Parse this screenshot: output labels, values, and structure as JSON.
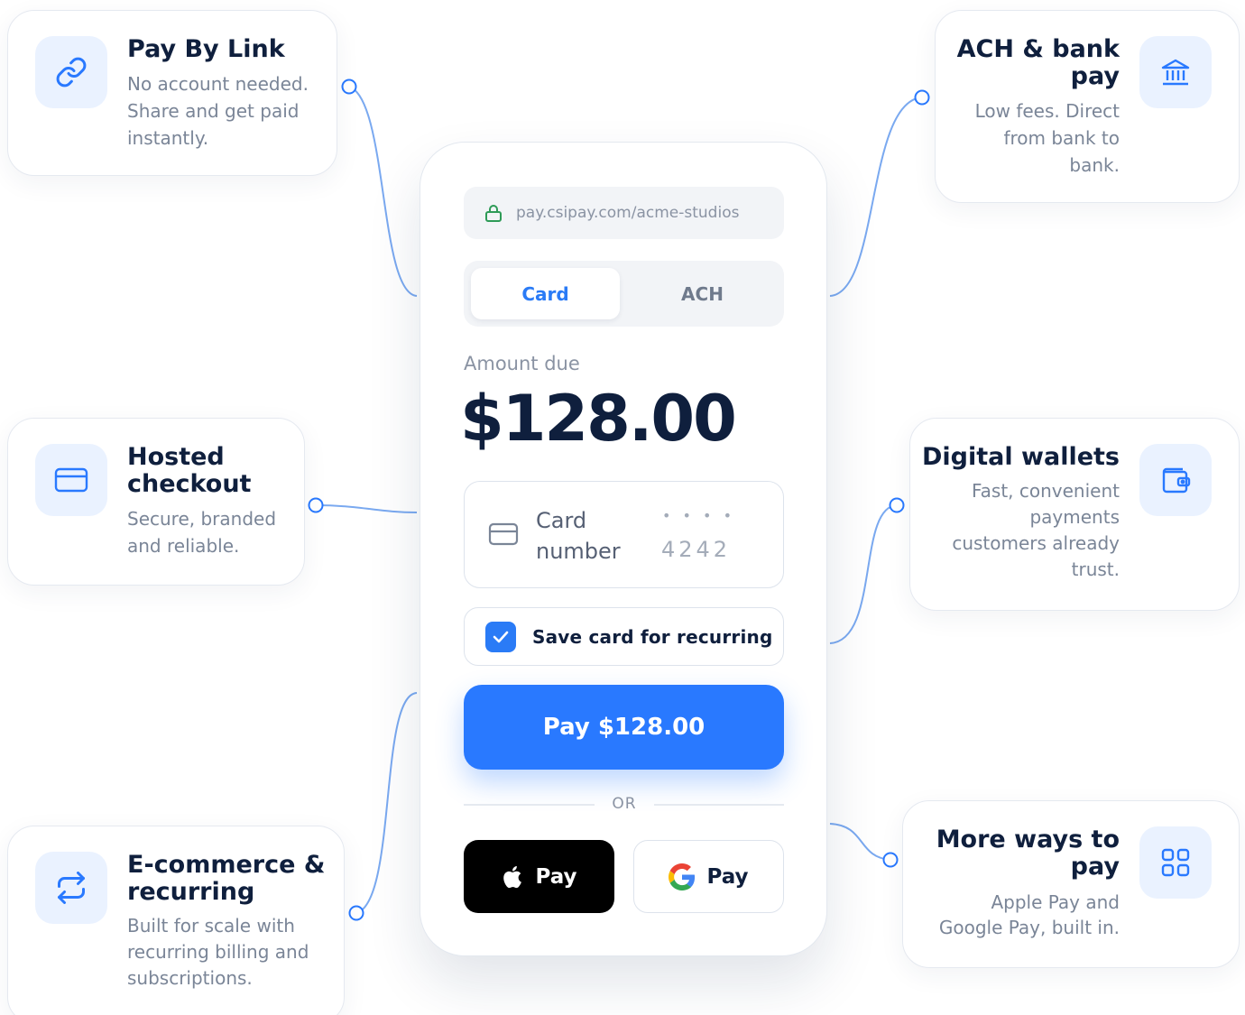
{
  "features": {
    "pay_by_link": {
      "title": "Pay By Link",
      "desc": [
        "No account needed.",
        "Share and get paid",
        "instantly."
      ],
      "icon": "link-icon"
    },
    "hosted_checkout": {
      "title": [
        "Hosted",
        "checkout"
      ],
      "desc": [
        "Secure, branded",
        "and reliable."
      ],
      "icon": "credit-card-icon"
    },
    "ecommerce": {
      "title": [
        "E-commerce &",
        "recurring"
      ],
      "desc": [
        "Built for scale with",
        "recurring billing and",
        "subscriptions."
      ],
      "icon": "repeat-icon"
    },
    "ach_bank": {
      "title": [
        "ACH & bank",
        "pay"
      ],
      "desc": [
        "Low fees. Direct",
        "from bank to",
        "bank."
      ],
      "icon": "bank-icon"
    },
    "digital_wallets": {
      "title": "Digital wallets",
      "desc": [
        "Fast, convenient",
        "payments",
        "customers already",
        "trust."
      ],
      "icon": "wallet-icon"
    },
    "more_ways": {
      "title": [
        "More ways to",
        "pay"
      ],
      "desc": [
        "Apple Pay and",
        "Google Pay, built in."
      ],
      "icon": "grid-icon"
    }
  },
  "checkout": {
    "url": "pay.csipay.com/acme-studios",
    "tabs": [
      "Card",
      "ACH"
    ],
    "active_tab": "Card",
    "amount_label": "Amount due",
    "amount": "$128.00",
    "card_field": {
      "label": [
        "Card",
        "number"
      ],
      "masked": "• • • •",
      "last4": "4242"
    },
    "save_card": {
      "label": "Save card for recurring",
      "checked": true
    },
    "pay_button": "Pay $128.00",
    "divider": "OR",
    "apple_pay": "Pay",
    "google_pay": "Pay"
  },
  "colors": {
    "accent": "#2979ff",
    "title": "#0f1f3d",
    "muted": "#7a8597",
    "icon_bg": "#eaf2ff",
    "lock_green": "#2e9b57",
    "connector": "#7aa9f0"
  }
}
